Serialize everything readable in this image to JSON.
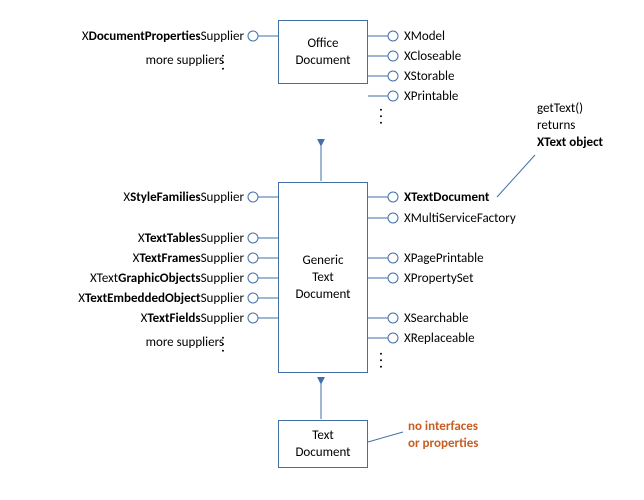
{
  "boxes": {
    "office": [
      "Office",
      "Document"
    ],
    "generic": [
      "Generic",
      "Text",
      "Document"
    ],
    "text": [
      "Text",
      "Document"
    ]
  },
  "office_left": [
    {
      "pre": "X",
      "bold": "DocumentProperties",
      "suf": "Supplier"
    }
  ],
  "office_left_more": {
    "text": "more suppliers",
    "dots": "..."
  },
  "office_right": [
    "XModel",
    "XCloseable",
    "XStorable",
    "XPrintable"
  ],
  "generic_left": [
    {
      "pre": "X",
      "bold": "StyleFamilies",
      "suf": "Supplier"
    },
    {
      "pre": "X",
      "bold": "TextTables",
      "suf": "Supplier"
    },
    {
      "pre": "X",
      "bold": "TextFrames",
      "suf": "Supplier"
    },
    {
      "pre": "XText",
      "bold": "GraphicObjects",
      "suf": "Supplier"
    },
    {
      "pre": "X",
      "bold": "TextEmbeddedObject",
      "suf": "Supplier"
    },
    {
      "pre": "X",
      "bold": "TextFields",
      "suf": "Supplier"
    }
  ],
  "generic_left_more": {
    "text": "more suppliers",
    "dots": "..."
  },
  "generic_right": [
    {
      "bold": "XTextDocument"
    },
    "XMultiServiceFactory",
    "XPagePrintable",
    "XPropertySet",
    "XSearchable",
    "XReplaceable"
  ],
  "note1": [
    "getText()",
    "returns",
    "XText object"
  ],
  "note2": [
    "no interfaces",
    "or properties"
  ],
  "colors": {
    "stroke": "#426fa8",
    "orange": "#c75e23"
  }
}
